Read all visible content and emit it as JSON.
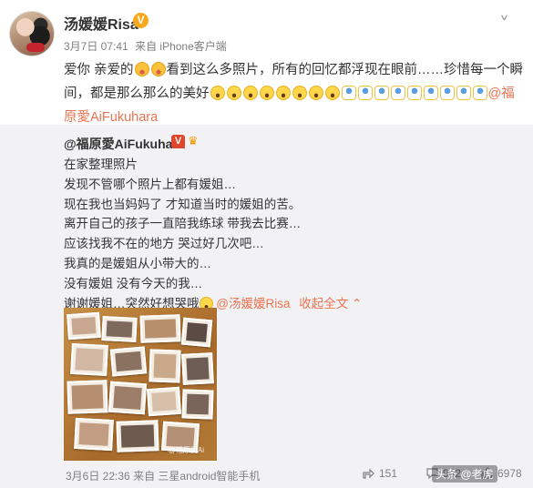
{
  "post": {
    "username": "汤媛媛Risa",
    "verified_badge": "V",
    "date": "3月7日 07:41",
    "source": "来自 iPhone客户端",
    "text_part1": "爱你 亲爱的",
    "text_part2": "看到这么多照片，所有的回忆都浮现在眼前……珍惜每一个瞬间，都是那么那么的美好",
    "mention": "@福原愛AiFukuhara",
    "icons": [
      "avatar",
      "verified-icon",
      "chevron-down-icon",
      "kiss-emoji-icon",
      "laugh-emoji-icon",
      "hug-emoji-icon"
    ]
  },
  "repost": {
    "author": "@福原愛AiFukuhara",
    "badge": "V",
    "lines": [
      "在家整理照片",
      "发现不管哪个照片上都有媛姐…",
      "现在我也当妈妈了 才知道当时的媛姐的苦。",
      "离开自己的孩子一直陪我练球 带我去比赛…",
      "应该找我不在的地方 哭过好几次吧…",
      "我真的是媛姐从小带大的…",
      "没有媛姐 没有今天的我…"
    ],
    "last_line": "谢谢媛姐…突然好想哭哦",
    "last_mention": "@汤媛媛Risa",
    "collapse_label": "收起全文 ⌃",
    "photo_watermark": "@福原愛Ai",
    "footer": {
      "date": "3月6日 22:36",
      "source": "来自 三星android智能手机",
      "repost_count": "151",
      "comment_count": "942",
      "like_count": "6978"
    },
    "overlay_watermark": "头条 @老虎"
  },
  "colors": {
    "accent": "#eb7350",
    "verified_gold": "#f8a81c",
    "verified_red": "#e0462b",
    "repost_bg": "#f2f2f5",
    "meta_gray": "#808080"
  }
}
